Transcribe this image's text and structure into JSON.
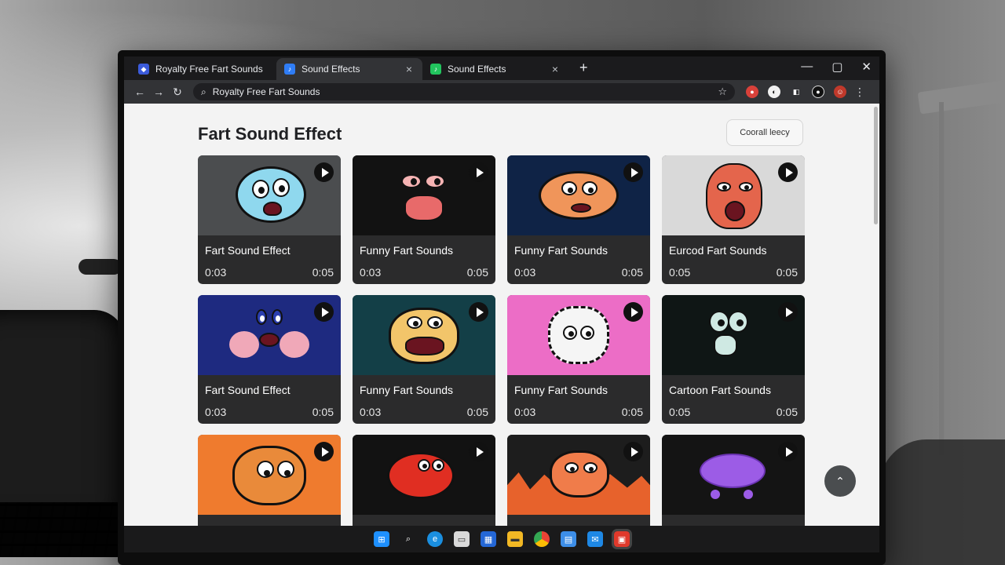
{
  "browser": {
    "tabs": [
      {
        "title": "Royalty Free Fart Sounds",
        "icon": "blue-shield-icon",
        "color": "#3b5bdb",
        "active": false
      },
      {
        "title": "Sound Effects",
        "icon": "blue-app-icon",
        "color": "#2f7df6",
        "active": true
      },
      {
        "title": "Sound Effects",
        "icon": "green-app-icon",
        "color": "#22c55e",
        "active": false
      }
    ],
    "new_tab_label": "+",
    "window_controls": {
      "minimize": "—",
      "maximize": "▢",
      "close": "✕"
    },
    "address": "Royalty Free Fart Sounds"
  },
  "page": {
    "title": "Fart Sound Effect",
    "filter_button": "Coorall leecy"
  },
  "cards": [
    {
      "title": "Fart Sound Effect",
      "start": "0:03",
      "end": "0:05",
      "bg": "#4b4d4f",
      "face_color": "#8fd8ee"
    },
    {
      "title": "Funny Fart Sounds",
      "start": "0:03",
      "end": "0:05",
      "bg": "#121212",
      "face_color": "#e86a6a"
    },
    {
      "title": "Funny Fart Sounds",
      "start": "0:03",
      "end": "0:05",
      "bg": "#0f2346",
      "face_color": "#f0955a"
    },
    {
      "title": "Eurcod Fart Sounds",
      "start": "0:05",
      "end": "0:05",
      "bg": "#d9d9d9",
      "face_color": "#e4654c"
    },
    {
      "title": "Fart Sound Effect",
      "start": "0:03",
      "end": "0:05",
      "bg": "#1e2a80",
      "face_color": "#f0a8b8"
    },
    {
      "title": "Funny Fart Sounds",
      "start": "0:03",
      "end": "0:05",
      "bg": "#133f47",
      "face_color": "#f2c56a"
    },
    {
      "title": "Funny Fart Sounds",
      "start": "0:03",
      "end": "0:05",
      "bg": "#ec6dc6",
      "face_color": "#f5f5f5"
    },
    {
      "title": "Cartoon Fart Sounds",
      "start": "0:05",
      "end": "0:05",
      "bg": "#0f1615",
      "face_color": "#cfe9e3"
    },
    {
      "title": "",
      "start": "",
      "end": "",
      "bg": "#ef7b2e",
      "face_color": "#e98a3a"
    },
    {
      "title": "",
      "start": "",
      "end": "",
      "bg": "#121212",
      "face_color": "#e02e22"
    },
    {
      "title": "",
      "start": "",
      "end": "",
      "bg": "#1d1d1d",
      "face_color": "#f07c4a"
    },
    {
      "title": "",
      "start": "",
      "end": "",
      "bg": "#141414",
      "face_color": "#9c5ce6"
    }
  ],
  "fab_label": "⌃",
  "taskbar": [
    {
      "icon": "windows-start-icon",
      "color": "#1e90ff"
    },
    {
      "icon": "search-icon",
      "color": "#1a1a1b"
    },
    {
      "icon": "edge-icon",
      "color": "#1a8fe0"
    },
    {
      "icon": "file-icon",
      "color": "#d9d9d9"
    },
    {
      "icon": "store-icon",
      "color": "#2467d6"
    },
    {
      "icon": "folder-icon",
      "color": "#f2b824"
    },
    {
      "icon": "chrome-icon",
      "color": "#34a853"
    },
    {
      "icon": "calendar-icon",
      "color": "#3d8ee8"
    },
    {
      "icon": "mail-icon",
      "color": "#1e88e5"
    },
    {
      "icon": "red-app-icon",
      "color": "#e0392b"
    }
  ]
}
